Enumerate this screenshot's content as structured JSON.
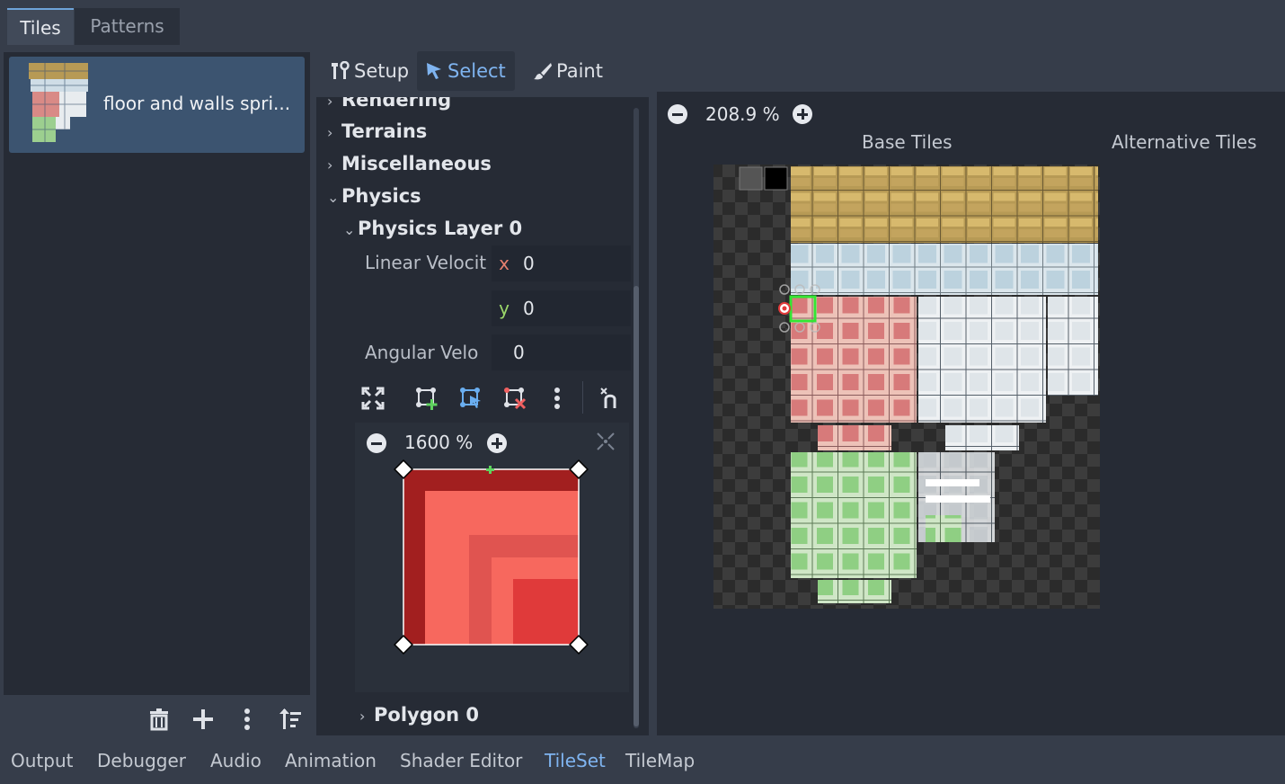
{
  "top_tabs": {
    "tiles": "Tiles",
    "patterns": "Patterns"
  },
  "source": {
    "label": "floor and walls spri..."
  },
  "modes": {
    "setup": "Setup",
    "select": "Select",
    "paint": "Paint"
  },
  "inspector": {
    "rendering": "Rendering",
    "terrains": "Terrains",
    "miscellaneous": "Miscellaneous",
    "physics": "Physics",
    "physics_layer": "Physics Layer 0",
    "linear_velocity_label": "Linear Velocit",
    "linear_x_axis": "x",
    "linear_x": "0",
    "linear_y_axis": "y",
    "linear_y": "0",
    "angular_velocity_label": "Angular Velo",
    "angular": "0",
    "polygon": "Polygon 0"
  },
  "poly_editor": {
    "zoom": "1600 %"
  },
  "atlas": {
    "zoom": "208.9 %",
    "base_tiles": "Base Tiles",
    "alternative_tiles": "Alternative Tiles"
  },
  "bottom_tabs": [
    "Output",
    "Debugger",
    "Audio",
    "Animation",
    "Shader Editor",
    "TileSet",
    "TileMap"
  ],
  "colors": {
    "accent": "#7fb4f0",
    "selection": "#33e633",
    "tile_red": "#f7685e"
  }
}
